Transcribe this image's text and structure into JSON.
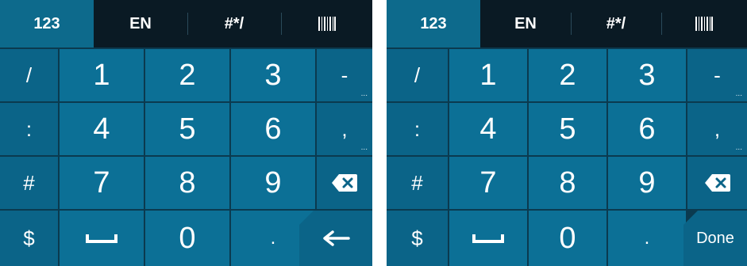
{
  "left": {
    "tabs": [
      "123",
      "EN",
      "#*/",
      "barcode"
    ],
    "rows": [
      [
        "/",
        "1",
        "2",
        "3",
        "-"
      ],
      [
        ":",
        "4",
        "5",
        "6",
        ","
      ],
      [
        "#",
        "7",
        "8",
        "9",
        "backspace"
      ],
      [
        "$",
        "space",
        "0",
        ".",
        "enter"
      ]
    ],
    "enter_label": ""
  },
  "right": {
    "tabs": [
      "123",
      "EN",
      "#*/",
      "barcode"
    ],
    "rows": [
      [
        "/",
        "1",
        "2",
        "3",
        "-"
      ],
      [
        ":",
        "4",
        "5",
        "6",
        ","
      ],
      [
        "#",
        "7",
        "8",
        "9",
        "backspace"
      ],
      [
        "$",
        "space",
        "0",
        ".",
        "done"
      ]
    ],
    "done_label": "Done"
  },
  "colors": {
    "tabbar": "#0a1a24",
    "tab_active": "#0d6a8c",
    "key": "#0c7096",
    "text": "#ffffff"
  }
}
